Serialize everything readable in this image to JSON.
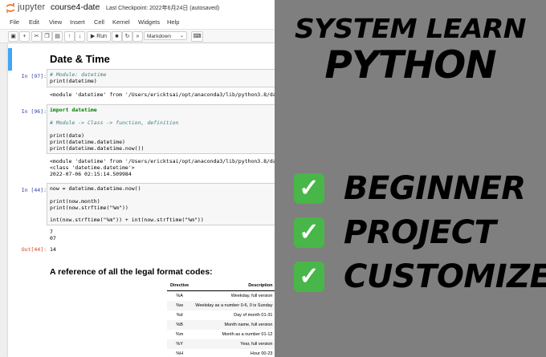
{
  "header": {
    "logo_text": "jupyter",
    "notebook_name": "course4-date",
    "checkpoint": "Last Checkpoint: 2022年6月24日  (autosaved)"
  },
  "menu": [
    "File",
    "Edit",
    "View",
    "Insert",
    "Cell",
    "Kernel",
    "Widgets",
    "Help"
  ],
  "toolbar": {
    "run_label": "▶ Run",
    "cell_type": "Markdown"
  },
  "notebook": {
    "heading": "Date & Time",
    "cells": [
      {
        "prompt": "In [97]:",
        "lines": [
          "# Module: datetime",
          "print(datetime)"
        ],
        "output": [
          "<module 'datetime' from '/Users/ericktsai/opt/anaconda3/lib/python3.8/da"
        ]
      },
      {
        "prompt": "In [96]:",
        "lines": [
          "import datetime",
          "",
          "# Module -> Class -> function, definition",
          "",
          "print(date)",
          "print(datetime.datetime)",
          "print(datetime.datetime.now())"
        ],
        "output": [
          "<module 'datetime' from '/Users/ericktsai/opt/anaconda3/lib/python3.8/da",
          "<class 'datetime.datetime'>",
          "2022-07-06 02:15:14.509984"
        ]
      },
      {
        "prompt": "In [44]:",
        "lines": [
          "now = datetime.datetime.now()",
          "",
          "print(now.month)",
          "print(now.strftime(\"%m\"))",
          "",
          "int(now.strftime(\"%m\")) + int(now.strftime(\"%m\"))"
        ],
        "output": [
          "7",
          "07"
        ],
        "out_prompt": "Out[44]:",
        "out_value": "14"
      }
    ],
    "reference_heading": "A reference of all the legal format codes:",
    "table": {
      "headers": [
        "Directive",
        "Description"
      ],
      "rows": [
        [
          "%A",
          "Weekday, full version"
        ],
        [
          "%w",
          "Weekday as a number 0-6, 0 is Sunday"
        ],
        [
          "%d",
          "Day of month 01-31"
        ],
        [
          "%B",
          "Month name, full version"
        ],
        [
          "%m",
          "Month as a number 01-12"
        ],
        [
          "%Y",
          "Year, full version"
        ],
        [
          "%H",
          "Hour 00-23"
        ]
      ]
    }
  },
  "banner": {
    "line1": "SYSTEM LEARN",
    "line2": "PYTHON",
    "items": [
      "BEGINNER",
      "PROJECT",
      "CUSTOMIZE"
    ],
    "check_color": "#49b649",
    "background": "#7f7f7f"
  }
}
